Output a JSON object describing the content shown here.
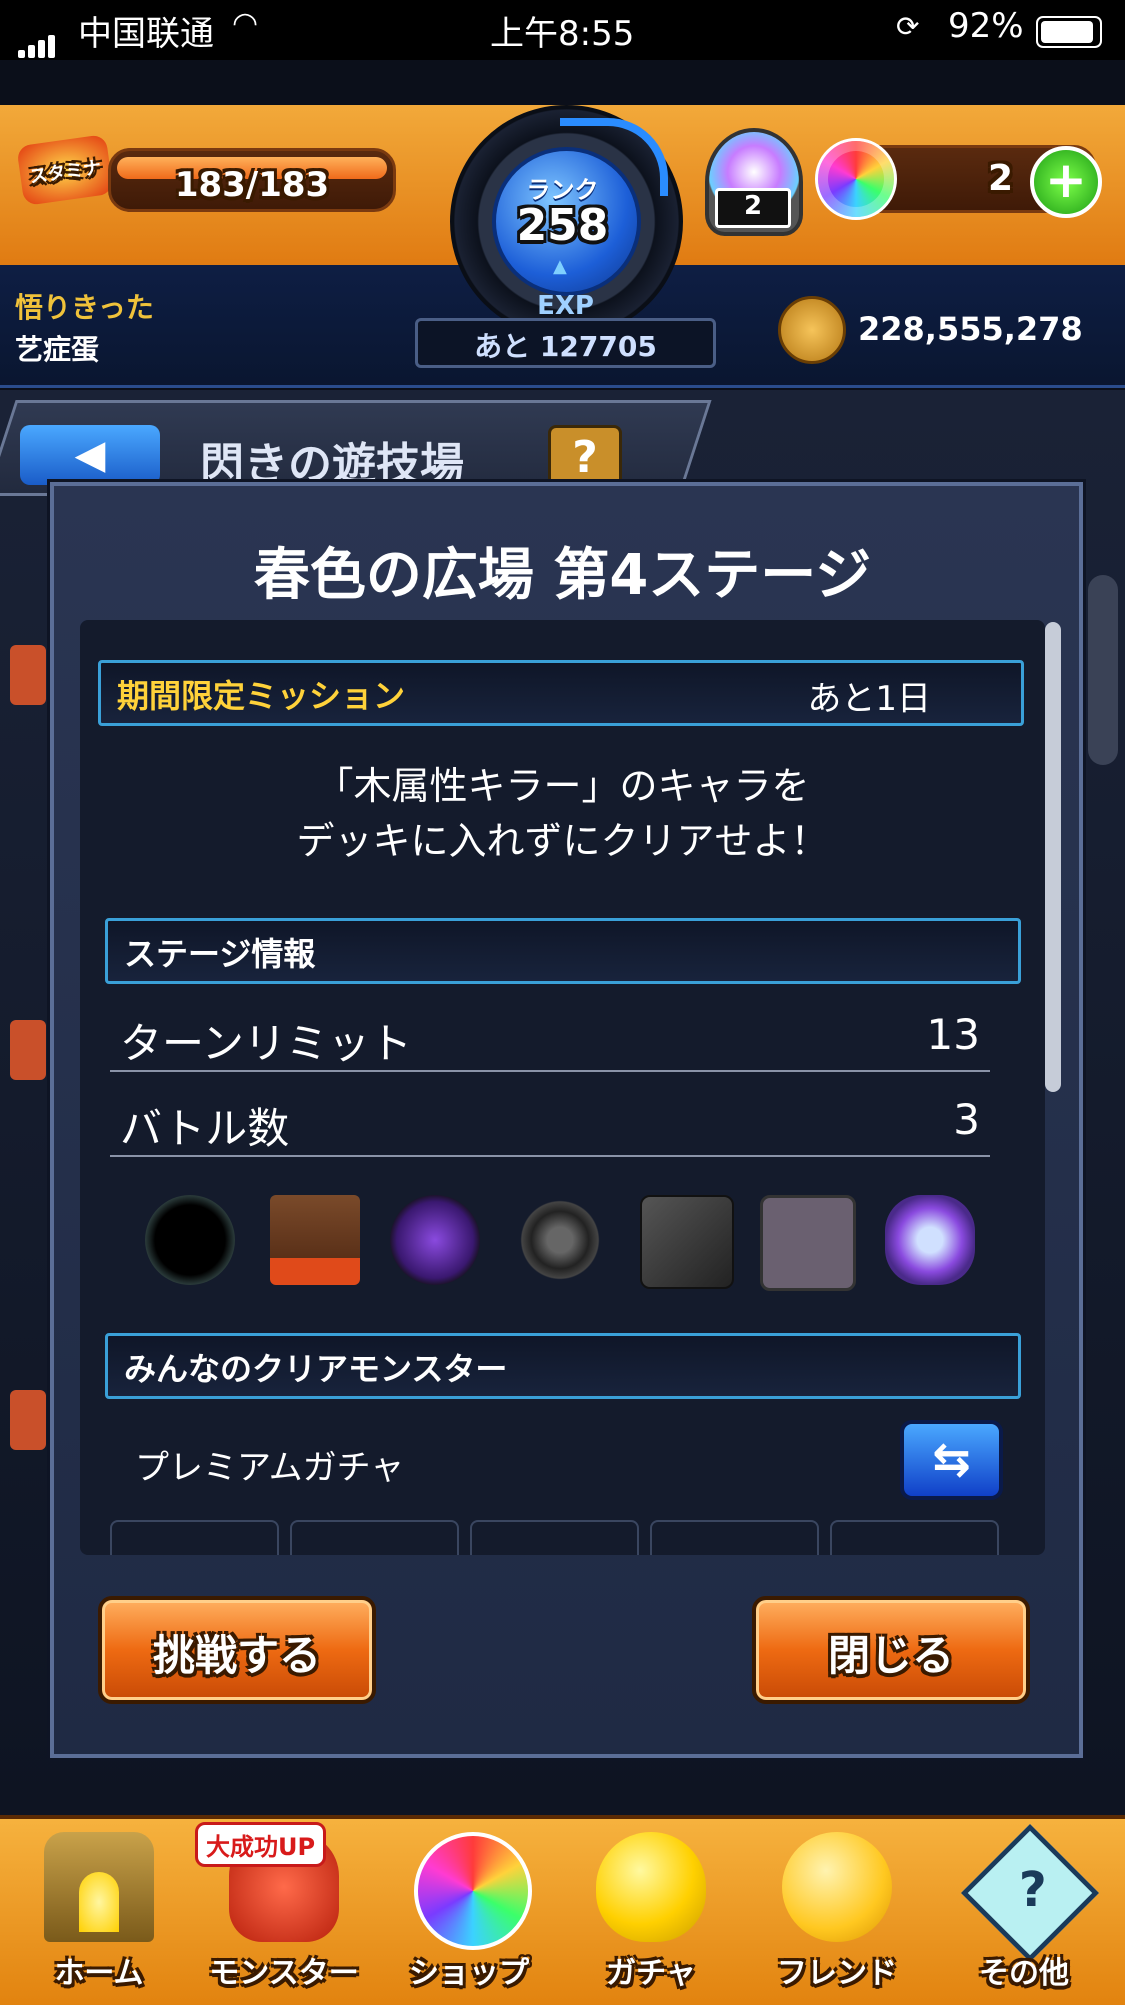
{
  "status_bar": {
    "carrier": "中国联通",
    "time": "上午8:55",
    "battery": "92%"
  },
  "hud": {
    "stamina_label": "スタミナ",
    "stamina": "183/183",
    "rank_label": "ランク",
    "rank": "258",
    "exp_label": "EXP",
    "exp_remaining": "あと 127705",
    "item_count": "2",
    "orb_count": "2",
    "player_title": "悟りきった",
    "player_name": "艺症蛋",
    "gold": "228,555,278"
  },
  "background": {
    "title": "閃きの遊技場",
    "help": "?"
  },
  "modal": {
    "title": "春色の広場 第4ステージ",
    "mission": {
      "header": "期間限定ミッション",
      "remaining": "あと1日",
      "line1": "「木属性キラー」のキャラを",
      "line2": "デッキに入れずにクリアせよ！"
    },
    "stage_info": {
      "header": "ステージ情報",
      "rows": [
        {
          "label": "ターンリミット",
          "value": "13"
        },
        {
          "label": "バトル数",
          "value": "3"
        }
      ]
    },
    "enemy_icons": [
      "black-hole-icon",
      "wood-block-flame-icon",
      "purple-warp-icon",
      "spiked-mine-icon",
      "dark-block-icon",
      "panel-trap-icon",
      "clock-robot-icon"
    ],
    "clear_monsters": {
      "header": "みんなのクリアモンスター",
      "source": "プレミアムガチャ"
    },
    "buttons": {
      "challenge": "挑戦する",
      "close": "閉じる"
    }
  },
  "nav": {
    "badge": "大成功UP",
    "items": [
      "ホーム",
      "モンスター",
      "ショップ",
      "ガチャ",
      "フレンド",
      "その他"
    ]
  }
}
